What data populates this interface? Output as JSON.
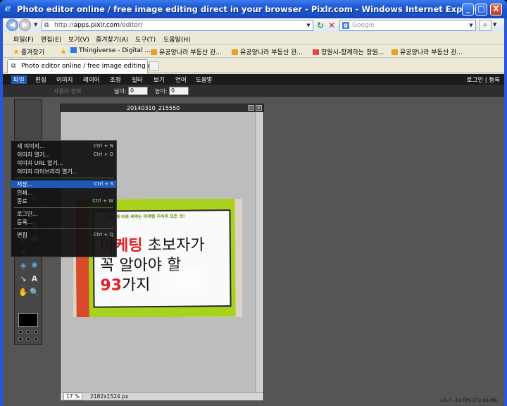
{
  "window": {
    "title": "Photo editor online / free image editing direct in your browser - Pixlr.com - Windows Internet Explorer",
    "min_label": "_",
    "max_label": "□",
    "close_label": "X"
  },
  "address": {
    "url_prefix": "http://",
    "url_host": "apps.pixlr.com",
    "url_path": "/editor/"
  },
  "search": {
    "placeholder": "Google"
  },
  "menubar": [
    "파일(F)",
    "편집(E)",
    "보기(V)",
    "즐겨찾기(A)",
    "도구(T)",
    "도움말(H)"
  ],
  "favorites": {
    "label": "즐겨찾기",
    "items": [
      "Thingiverse - Digital ...",
      "유공양나라 부동산 관...",
      "유공양나라 부동산 관...",
      "창원시-함께하는 창원...",
      "유공양나라 부동산 관..."
    ]
  },
  "tab": {
    "label": "Photo editor online / free image editing di..."
  },
  "pixlr": {
    "menu": [
      "파일",
      "편집",
      "이미지",
      "레이어",
      "조정",
      "필터",
      "보기",
      "언어",
      "도움말"
    ],
    "right_links": "로그인 | 등록",
    "options": {
      "width_label": "넓이:",
      "width_value": "0",
      "height_label": "높이:",
      "height_value": "0",
      "faded_label": "사용자 정의"
    },
    "file_menu": [
      {
        "label": "새 이미지...",
        "shortcut": "Ctrl + N"
      },
      {
        "label": "이미지 열기...",
        "shortcut": "Ctrl + O"
      },
      {
        "label": "이미지 URL 열기...",
        "shortcut": ""
      },
      {
        "label": "이미지 라이브러리 열기...",
        "shortcut": ""
      },
      {
        "label": "저장...",
        "shortcut": "Ctrl + S"
      },
      {
        "label": "인쇄...",
        "shortcut": ""
      },
      {
        "label": "종료",
        "shortcut": "Ctrl + W"
      },
      {
        "label": "로그인...",
        "shortcut": ""
      },
      {
        "label": "등록...",
        "shortcut": ""
      },
      {
        "label": "편집",
        "shortcut": "Ctrl + Q"
      }
    ],
    "document": {
      "title": "20140310_215550",
      "zoom": "17 %",
      "size": "2182x1524 px"
    },
    "photo_text": {
      "subtitle": "실전에 바로 써먹는 마케팅 지식의 모든 것!",
      "line1_red": "마케팅",
      "line1_rest": " 초보자가",
      "line2": "꼭 알아야 할",
      "line3_red": "93",
      "line3_rest": "가지"
    },
    "status": "v.6.7 - 61 FPS 272.86 MB"
  }
}
